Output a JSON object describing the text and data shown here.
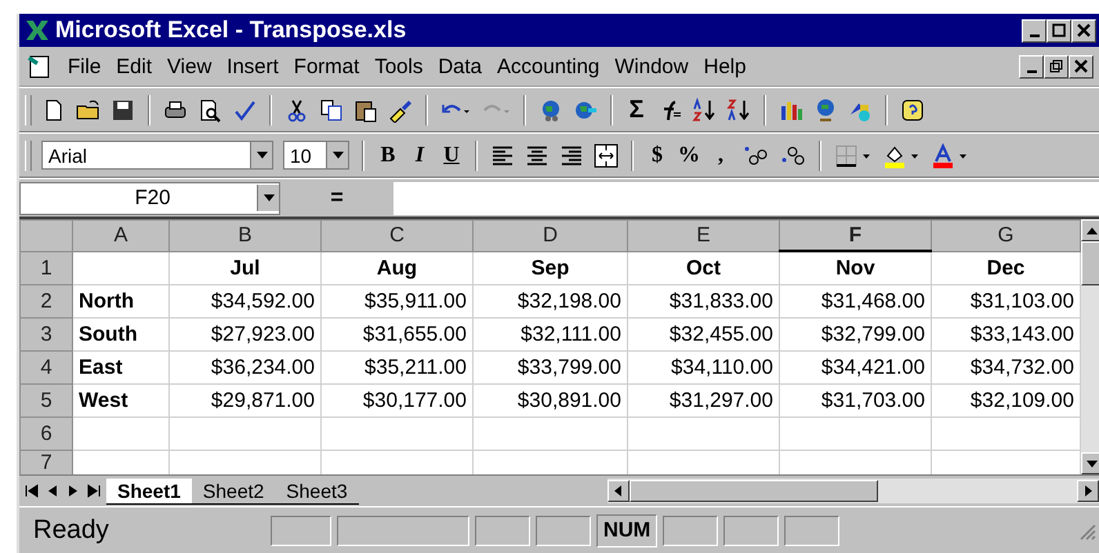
{
  "window": {
    "title": "Microsoft Excel - Transpose.xls"
  },
  "menu": [
    "File",
    "Edit",
    "View",
    "Insert",
    "Format",
    "Tools",
    "Data",
    "Accounting",
    "Window",
    "Help"
  ],
  "standard_toolbar": {
    "sum_symbol": "Σ"
  },
  "formatting_toolbar": {
    "font": "Arial",
    "size": "10",
    "bold": "B",
    "italic": "I",
    "underline": "U",
    "currency": "$",
    "percent": "%",
    "comma": ","
  },
  "formula_bar": {
    "name_box": "F20",
    "equals": "="
  },
  "columns": [
    {
      "label": "A",
      "selected": false
    },
    {
      "label": "B",
      "selected": false
    },
    {
      "label": "C",
      "selected": false
    },
    {
      "label": "D",
      "selected": false
    },
    {
      "label": "E",
      "selected": false
    },
    {
      "label": "F",
      "selected": true
    },
    {
      "label": "G",
      "selected": false
    }
  ],
  "rows": [
    {
      "number": "1",
      "cells": [
        "",
        "Jul",
        "Aug",
        "Sep",
        "Oct",
        "Nov",
        "Dec"
      ]
    },
    {
      "number": "2",
      "cells": [
        "North",
        "$34,592.00",
        "$35,911.00",
        "$32,198.00",
        "$31,833.00",
        "$31,468.00",
        "$31,103.00"
      ]
    },
    {
      "number": "3",
      "cells": [
        "South",
        "$27,923.00",
        "$31,655.00",
        "$32,111.00",
        "$32,455.00",
        "$32,799.00",
        "$33,143.00"
      ]
    },
    {
      "number": "4",
      "cells": [
        "East",
        "$36,234.00",
        "$35,211.00",
        "$33,799.00",
        "$34,110.00",
        "$34,421.00",
        "$34,732.00"
      ]
    },
    {
      "number": "5",
      "cells": [
        "West",
        "$29,871.00",
        "$30,177.00",
        "$30,891.00",
        "$31,297.00",
        "$31,703.00",
        "$32,109.00"
      ]
    },
    {
      "number": "6",
      "cells": [
        "",
        "",
        "",
        "",
        "",
        "",
        ""
      ]
    },
    {
      "number": "7",
      "cells": [
        "",
        "",
        "",
        "",
        "",
        "",
        ""
      ]
    }
  ],
  "sheet_tabs": [
    {
      "label": "Sheet1",
      "selected": true
    },
    {
      "label": "Sheet2",
      "selected": false
    },
    {
      "label": "Sheet3",
      "selected": false
    }
  ],
  "status_bar": {
    "message": "Ready",
    "num_indicator": "NUM"
  }
}
